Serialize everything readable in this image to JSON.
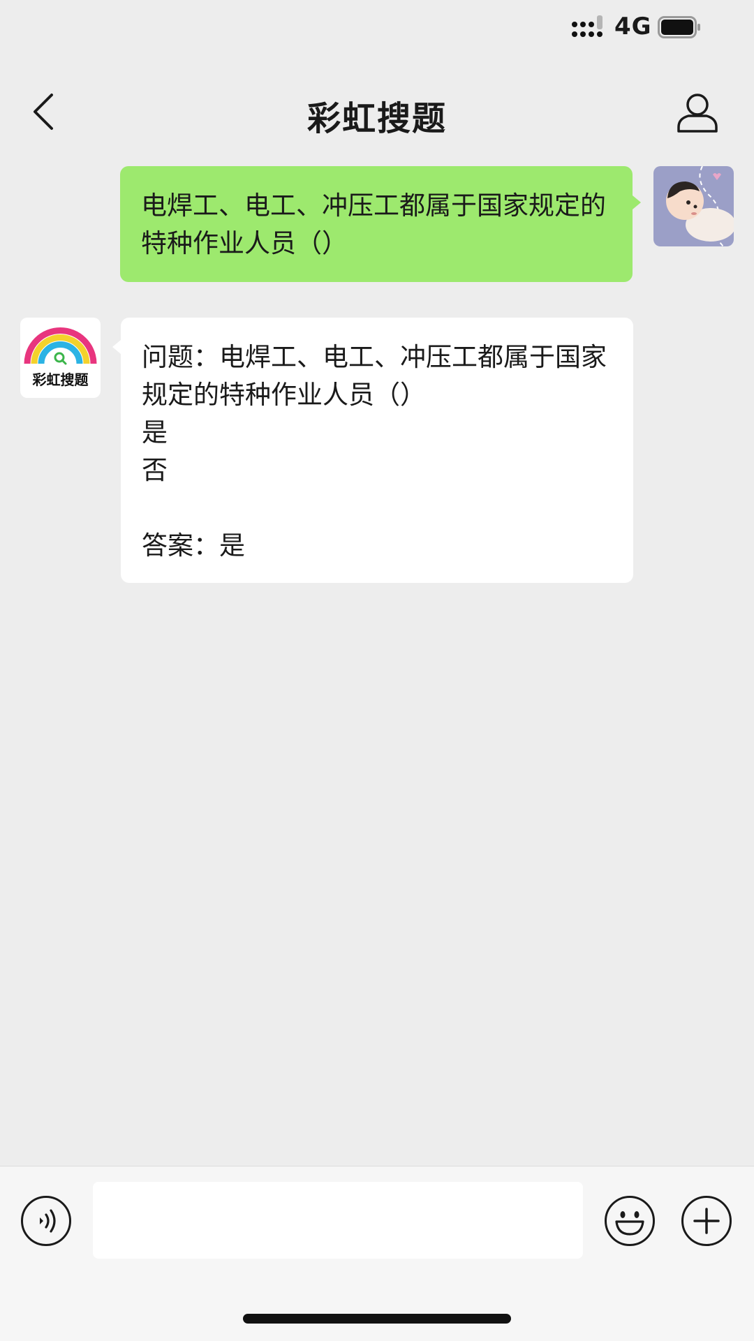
{
  "status_bar": {
    "network": "4G"
  },
  "header": {
    "title": "彩虹搜题"
  },
  "messages": [
    {
      "side": "sent",
      "text": "电焊工、电工、冲压工都属于国家规定的特种作业人员（）",
      "avatar": "baby-photo-avatar"
    },
    {
      "side": "received",
      "text": "问题：电焊工、电工、冲压工都属于国家规定的特种作业人员（）\n是\n否\n\n答案：是",
      "avatar": {
        "icon": "rainbow-logo-icon",
        "label": "彩虹搜题"
      }
    }
  ],
  "input_bar": {
    "placeholder": ""
  },
  "colors": {
    "background": "#ededed",
    "sent_bubble": "#9de96e",
    "received_bubble": "#ffffff",
    "input_bar": "#f6f6f6"
  },
  "icons": [
    "signal-icon",
    "battery-icon",
    "back-arrow-icon",
    "person-icon",
    "voice-icon",
    "emoji-icon",
    "plus-icon"
  ]
}
